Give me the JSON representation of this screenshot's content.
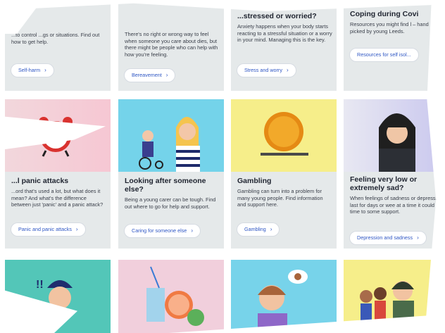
{
  "row1": [
    {
      "title": "",
      "text": "...to control ...gs or situations. Find out how to get help.",
      "button": "Self-harm"
    },
    {
      "title": "",
      "text": "There's no right or wrong way to feel when someone you care about dies, but there might be people who can help with how you're feeling.",
      "button": "Bereavement"
    },
    {
      "title": "...stressed or worried?",
      "text": "Anxiety happens when your body starts reacting to a stressful situation or a worry in your mind. Managing this is the key.",
      "button": "Stress and worry"
    },
    {
      "title": "Coping during Covi",
      "text": "Resources you might find l – hand picked by young Leeds.",
      "button": "Resources for self isol..."
    }
  ],
  "row2": [
    {
      "title": "...l panic attacks",
      "text": "...ord that's used a lot, but what does it mean? And what's the difference between just 'panic' and a panic attack?",
      "button": "Panic and panic attacks",
      "bg": "#f2d7dc"
    },
    {
      "title": "Looking after someone else?",
      "text": "Being a young carer can be tough. Find out where to go for help and support.",
      "button": "Caring for someone else",
      "bg": "#74d3ea"
    },
    {
      "title": "Gambling",
      "text": "Gambling can turn into a problem for many young people. Find information and support here.",
      "button": "Gambling",
      "bg": "#f6ee8a"
    },
    {
      "title": "Feeling very low or extremely sad?",
      "text": "When feelings of sadness or depression last for days or wee at a time it could be time to some support.",
      "button": "Depression and sadness",
      "bg": "#c8c6ee"
    }
  ],
  "row3_bg": [
    "#53c6b8",
    "#f1cfdc",
    "#77d3ea",
    "#f6ee8a"
  ],
  "colors": {
    "accent": "#2f57c4",
    "card": "#e5e9ea"
  }
}
